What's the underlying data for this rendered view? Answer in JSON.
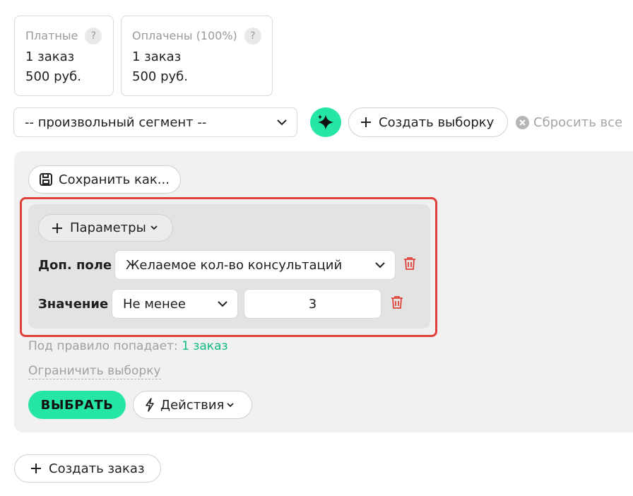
{
  "stats": {
    "paid": {
      "title": "Платные",
      "count": "1 заказ",
      "sum": "500 руб.",
      "help": "?"
    },
    "paid_done": {
      "title": "Оплачены (100%)",
      "count": "1 заказ",
      "sum": "500 руб.",
      "help": "?"
    }
  },
  "segment": {
    "value": "-- произвольный сегмент --"
  },
  "toolbar": {
    "create_selection": "Создать выборку",
    "reset_all": "Сбросить все"
  },
  "panel": {
    "save_as": "Сохранить как...",
    "params_button": "Параметры",
    "field_label": "Доп. поле",
    "field_value": "Желаемое кол-во консультаций",
    "value_label": "Значение",
    "operator_value": "Не менее",
    "number_value": "3",
    "rule_text": "Под правило попадает:",
    "rule_count": "1 заказ",
    "limit_link": "Ограничить выборку",
    "select_button": "ВЫБРАТЬ",
    "actions_button": "Действия"
  },
  "footer": {
    "create_order": "Создать заказ"
  },
  "colors": {
    "accent": "#26e6a6",
    "highlight": "#e0413a",
    "danger": "#e0413a",
    "link_green": "#10b981"
  }
}
